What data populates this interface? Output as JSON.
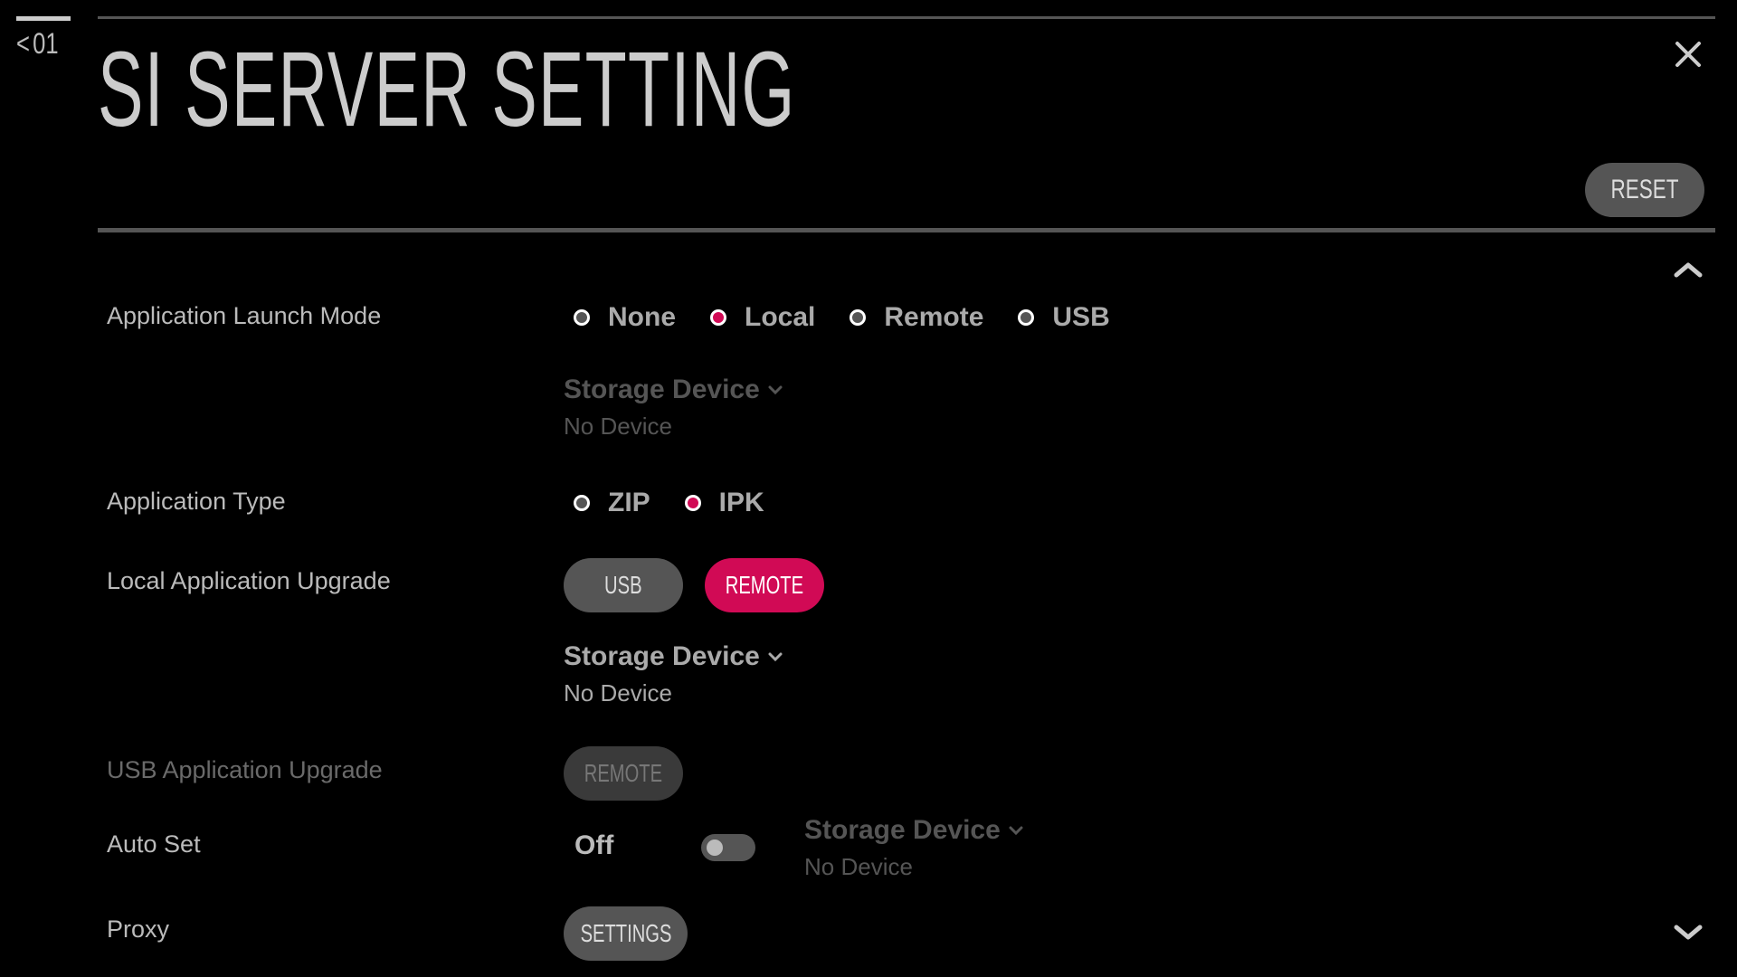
{
  "header": {
    "back_label": "01",
    "title": "SI SERVER SETTING",
    "reset_label": "RESET"
  },
  "colors": {
    "accent": "#d10a55",
    "button": "#555555",
    "text": "#bbbbbb",
    "disabled_text": "#6a6a6a"
  },
  "settings": {
    "launch_mode": {
      "label": "Application Launch Mode",
      "options": [
        "None",
        "Local",
        "Remote",
        "USB"
      ],
      "selected": "Local",
      "storage_label": "Storage Device",
      "storage_value": "No Device"
    },
    "app_type": {
      "label": "Application Type",
      "options": [
        "ZIP",
        "IPK"
      ],
      "selected": "IPK"
    },
    "local_upgrade": {
      "label": "Local Application Upgrade",
      "buttons": [
        "USB",
        "REMOTE"
      ],
      "active": "REMOTE",
      "storage_label": "Storage Device",
      "storage_value": "No Device"
    },
    "usb_upgrade": {
      "label": "USB Application Upgrade",
      "button": "REMOTE"
    },
    "auto_set": {
      "label": "Auto Set",
      "state": "Off",
      "storage_label": "Storage Device",
      "storage_value": "No Device"
    },
    "proxy": {
      "label": "Proxy",
      "button": "SETTINGS"
    }
  }
}
